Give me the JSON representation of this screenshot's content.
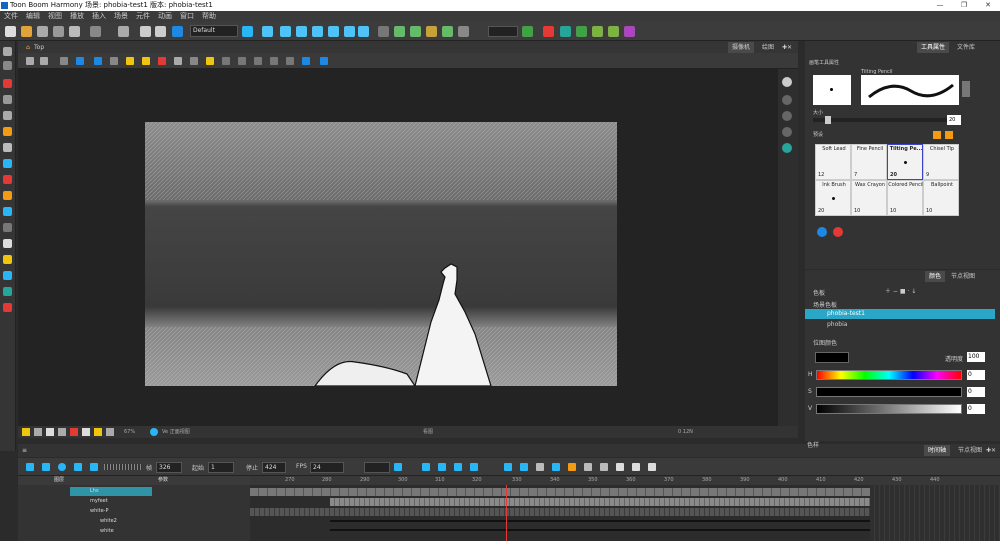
{
  "window": {
    "title": "Toon Boom Harmony 场景: phobia-test1 版本: phobia-test1",
    "controls": [
      "—",
      "❐",
      "✕"
    ]
  },
  "menu": [
    "文件",
    "编辑",
    "视图",
    "播放",
    "插入",
    "场景",
    "元件",
    "动画",
    "窗口",
    "帮助"
  ],
  "toolbar": {
    "preset": "Default"
  },
  "camera_view": {
    "tabs": [
      "Top",
      "摄像机",
      "绘图"
    ],
    "status": {
      "zoom": "67%",
      "view": "Ve 正面视图",
      "mode": "看图",
      "coords": "0 12N"
    }
  },
  "timeline": {
    "tabs": [
      "时间轴",
      "节点视图"
    ],
    "frame_label": "帧",
    "frame_value": "326",
    "start_label": "起始",
    "start_value": "1",
    "stop_label": "停止",
    "stop_value": "424",
    "fps_label": "FPS",
    "fps_value": "24",
    "header_layers": "图层",
    "header_params": "参数",
    "layers": [
      {
        "name": "Lhs",
        "selected": true
      },
      {
        "name": "myfeet",
        "selected": false
      },
      {
        "name": "white-P",
        "selected": false
      },
      {
        "name": "white2",
        "selected": false
      },
      {
        "name": "white",
        "selected": false
      }
    ],
    "ruler": [
      "270",
      "280",
      "290",
      "300",
      "310",
      "320",
      "330",
      "340",
      "350",
      "360",
      "370",
      "380",
      "390",
      "400",
      "410",
      "420",
      "430",
      "440"
    ]
  },
  "tool_properties": {
    "tabs": [
      "工具属性",
      "文件库"
    ],
    "section": "画笔工具属性",
    "brush_name": "Tilting Pencil",
    "size_label": "大小",
    "size_value": "20",
    "presets_label": "预设",
    "brushes": [
      {
        "name": "Soft Lead",
        "size": "12"
      },
      {
        "name": "Fine Pencil",
        "size": "7"
      },
      {
        "name": "Tilting Pe...",
        "size": "20"
      },
      {
        "name": "Chisel Tip",
        "size": "9"
      },
      {
        "name": "Ink Brush",
        "size": "20"
      },
      {
        "name": "Wax Crayon",
        "size": "10"
      },
      {
        "name": "Colored Pencil",
        "size": "10"
      },
      {
        "name": "Ballpoint",
        "size": "10"
      }
    ]
  },
  "color_panel": {
    "tabs": [
      "颜色",
      "节点视图"
    ],
    "palette_label": "色板",
    "scene_palette_label": "场景色板",
    "palettes": [
      {
        "name": "phobia-test1",
        "selected": true
      },
      {
        "name": "phobia",
        "selected": false
      }
    ],
    "bg_color_label": "位图颜色",
    "opacity_label": "透明度",
    "opacity_value": "100",
    "channels": [
      {
        "label": "H",
        "value": "0"
      },
      {
        "label": "S",
        "value": "0"
      },
      {
        "label": "V",
        "value": "0"
      }
    ],
    "swatches_label": "色样"
  }
}
